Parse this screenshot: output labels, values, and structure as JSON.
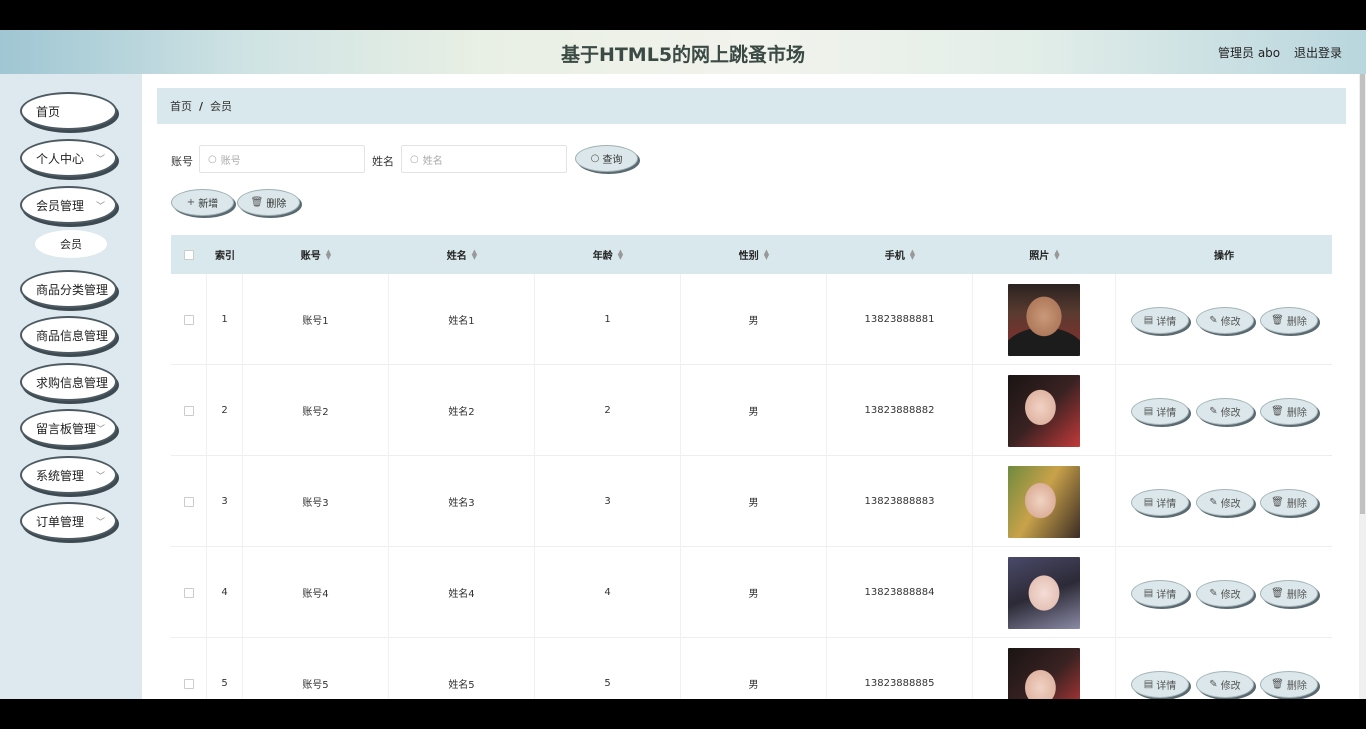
{
  "header": {
    "title": "基于HTML5的网上跳蚤市场",
    "user": "管理员 abo",
    "logout": "退出登录"
  },
  "sidebar": {
    "items": [
      {
        "label": "首页",
        "has_chevron": false
      },
      {
        "label": "个人中心",
        "has_chevron": true
      },
      {
        "label": "会员管理",
        "has_chevron": true
      },
      {
        "label": "商品分类管理",
        "has_chevron": false
      },
      {
        "label": "商品信息管理",
        "has_chevron": false
      },
      {
        "label": "求购信息管理",
        "has_chevron": false
      },
      {
        "label": "留言板管理",
        "has_chevron": true
      },
      {
        "label": "系统管理",
        "has_chevron": true
      },
      {
        "label": "订单管理",
        "has_chevron": true
      }
    ],
    "submenu": "会员"
  },
  "breadcrumb": {
    "home": "首页",
    "sep": "/",
    "current": "会员"
  },
  "search": {
    "account_label": "账号",
    "account_placeholder": "账号",
    "name_label": "姓名",
    "name_placeholder": "姓名",
    "query_btn": "查询"
  },
  "toolbar": {
    "add_btn": "新增",
    "delete_btn": "删除"
  },
  "table": {
    "headers": {
      "index": "索引",
      "account": "账号",
      "name": "姓名",
      "age": "年龄",
      "gender": "性别",
      "phone": "手机",
      "photo": "照片",
      "ops": "操作"
    },
    "rows": [
      {
        "index": "1",
        "account": "账号1",
        "name": "姓名1",
        "age": "1",
        "gender": "男",
        "phone": "13823888881"
      },
      {
        "index": "2",
        "account": "账号2",
        "name": "姓名2",
        "age": "2",
        "gender": "男",
        "phone": "13823888882"
      },
      {
        "index": "3",
        "account": "账号3",
        "name": "姓名3",
        "age": "3",
        "gender": "男",
        "phone": "13823888883"
      },
      {
        "index": "4",
        "account": "账号4",
        "name": "姓名4",
        "age": "4",
        "gender": "男",
        "phone": "13823888884"
      },
      {
        "index": "5",
        "account": "账号5",
        "name": "姓名5",
        "age": "5",
        "gender": "男",
        "phone": "13823888885"
      }
    ],
    "actions": {
      "detail": "详情",
      "edit": "修改",
      "delete": "删除"
    }
  },
  "colors": {
    "accent_bg": "#d9e8ec",
    "sidebar_bg": "#dde9ee",
    "button_bg": "#dbe7ea"
  }
}
